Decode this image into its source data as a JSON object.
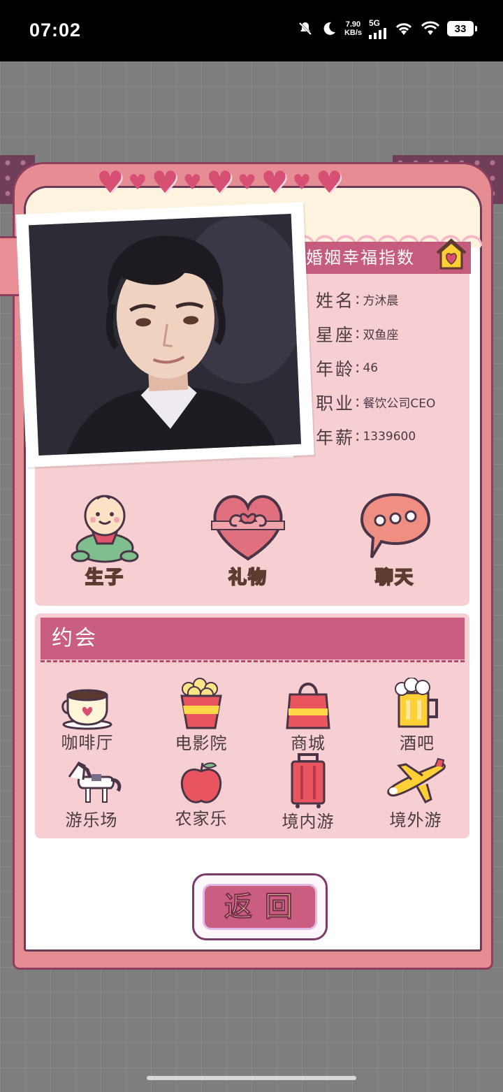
{
  "status_bar": {
    "time": "07:02",
    "speed_value": "7.90",
    "speed_unit": "KB/s",
    "network": "5G",
    "battery": "33",
    "icons": [
      "mute-icon",
      "moon-icon",
      "signal-icon",
      "wifi-icon",
      "wifi-icon",
      "battery-icon"
    ]
  },
  "card": {
    "index_title": "婚姻幸福指数",
    "profile": [
      {
        "key": "姓名",
        "value": "方沐晨"
      },
      {
        "key": "星座",
        "value": "双鱼座"
      },
      {
        "key": "年龄",
        "value": "46"
      },
      {
        "key": "职业",
        "value": "餐饮公司CEO"
      },
      {
        "key": "年薪",
        "value": "1339600"
      }
    ],
    "separator": ":",
    "actions": [
      {
        "label": "生子",
        "icon": "baby-icon"
      },
      {
        "label": "礼物",
        "icon": "gift-heart-icon"
      },
      {
        "label": "聊天",
        "icon": "chat-bubble-icon"
      }
    ],
    "date_section": {
      "title": "约会",
      "places": [
        {
          "label": "咖啡厅",
          "icon": "coffee-cup-icon"
        },
        {
          "label": "电影院",
          "icon": "popcorn-icon"
        },
        {
          "label": "商城",
          "icon": "shopping-bag-icon"
        },
        {
          "label": "酒吧",
          "icon": "beer-mug-icon"
        },
        {
          "label": "游乐场",
          "icon": "carousel-horse-icon"
        },
        {
          "label": "农家乐",
          "icon": "apple-icon"
        },
        {
          "label": "境内游",
          "icon": "suitcase-icon"
        },
        {
          "label": "境外游",
          "icon": "airplane-icon"
        }
      ]
    },
    "return_label": "返回"
  },
  "colors": {
    "accent": "#c95e80",
    "card_border": "#8e3f5d",
    "panel": "#f7cfd2",
    "label_yellow": "#ffcf36"
  }
}
